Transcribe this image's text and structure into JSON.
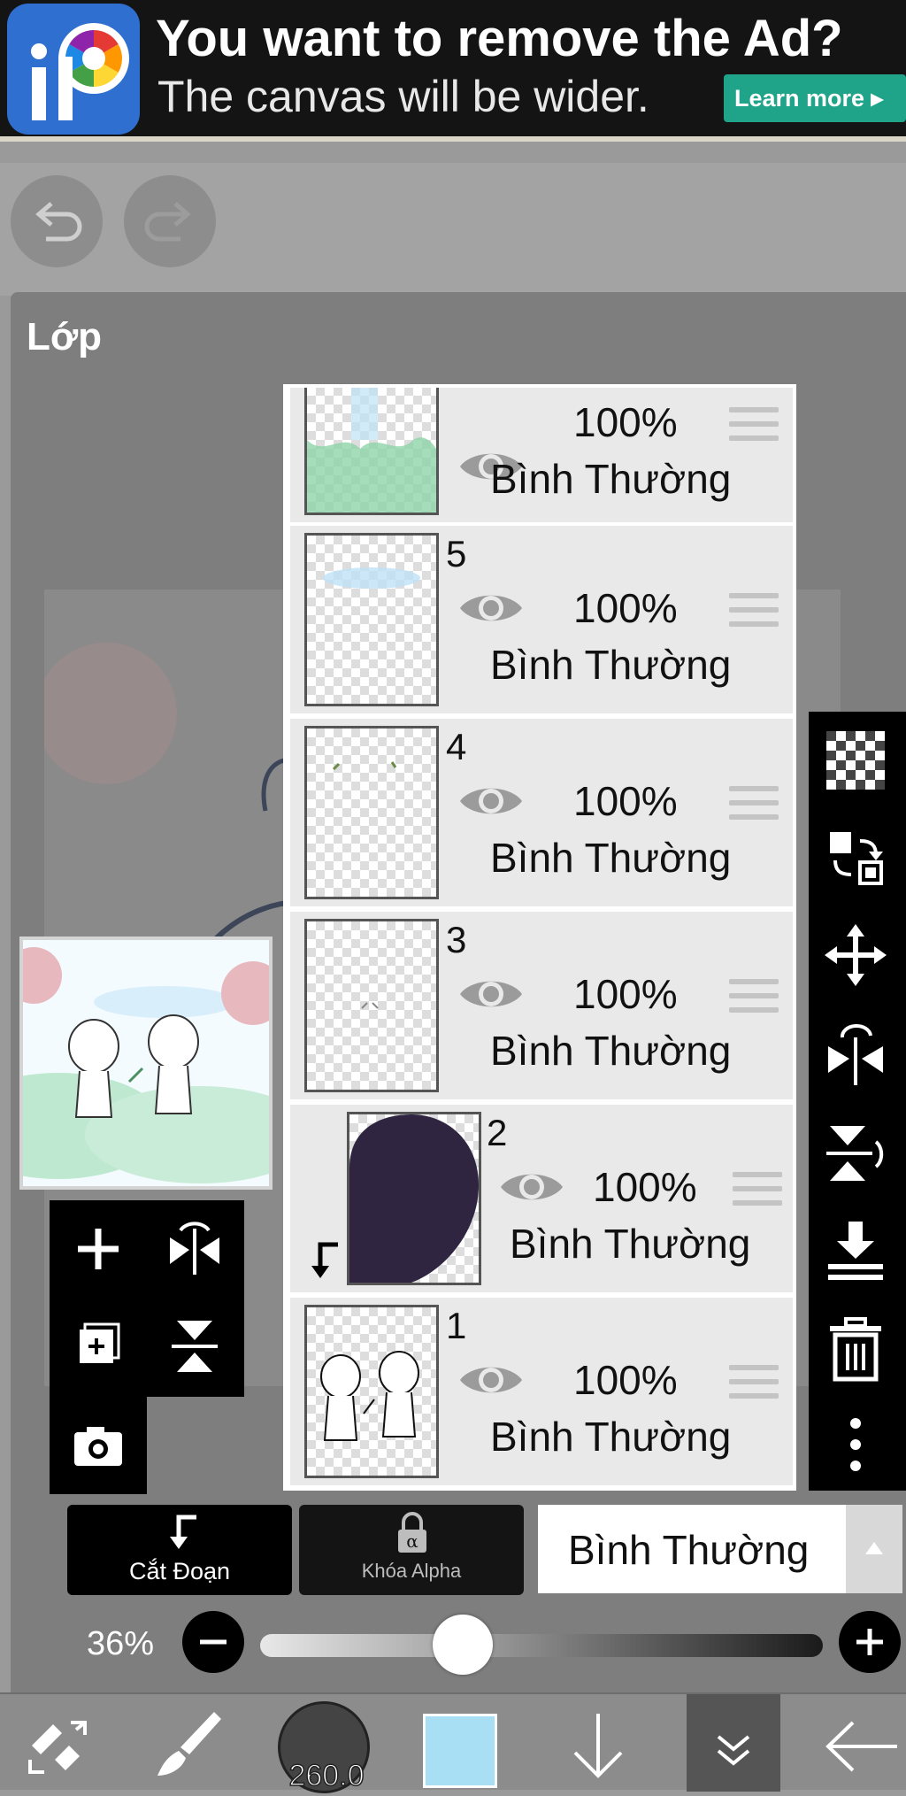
{
  "ad": {
    "title": "You want to remove the Ad?",
    "subtitle": "The canvas will be wider.",
    "learn_more": "Learn more ▸"
  },
  "panel": {
    "title": "Lớp"
  },
  "layers": [
    {
      "number": "",
      "opacity": "100%",
      "blend": "Bình Thường"
    },
    {
      "number": "5",
      "opacity": "100%",
      "blend": "Bình Thường"
    },
    {
      "number": "4",
      "opacity": "100%",
      "blend": "Bình Thường"
    },
    {
      "number": "3",
      "opacity": "100%",
      "blend": "Bình Thường"
    },
    {
      "number": "2",
      "opacity": "100%",
      "blend": "Bình Thường"
    },
    {
      "number": "1",
      "opacity": "100%",
      "blend": "Bình Thường"
    }
  ],
  "actions": {
    "clip": "Cắt Đoạn",
    "alpha_lock": "Khóa Alpha",
    "blend_mode": "Bình Thường"
  },
  "opacity": {
    "label": "36%",
    "value": 0.36
  },
  "toolbar": {
    "brush_size": "260.0",
    "color": "#a9dff5"
  }
}
